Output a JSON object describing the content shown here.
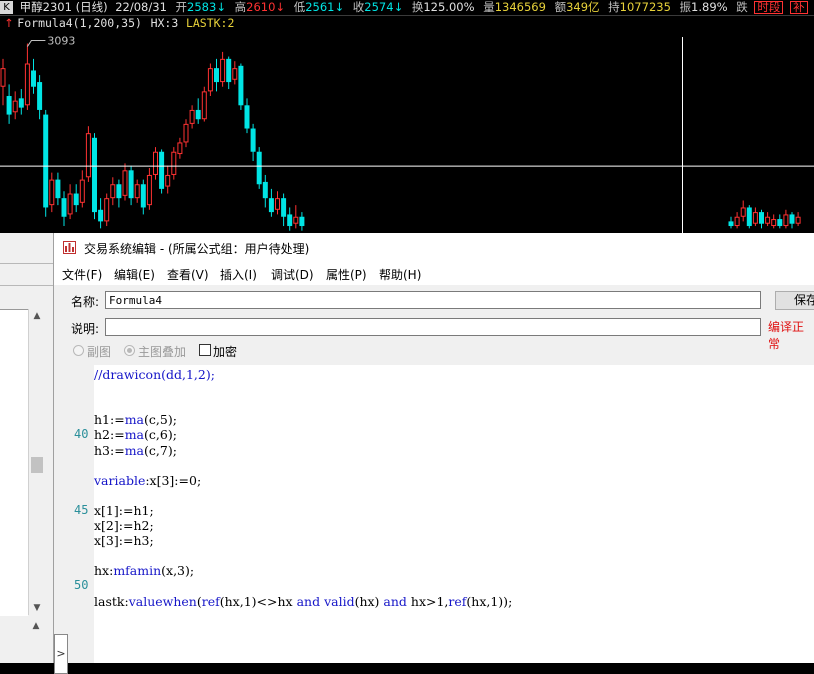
{
  "quote_bar": {
    "k_label": "K",
    "symbol": "甲醇2301",
    "period": "(日线)",
    "date": "22/08/31",
    "open_label": "开",
    "open_value": "2583",
    "open_arrow": "↓",
    "high_label": "高",
    "high_value": "2610",
    "high_arrow": "↓",
    "low_label": "低",
    "low_value": "2561",
    "low_arrow": "↓",
    "close_label": "收",
    "close_value": "2574",
    "close_arrow": "↓",
    "turnover_label": "换",
    "turnover_value": "125.00%",
    "volume_label": "量",
    "volume_value": "1346569",
    "amount_label": "额",
    "amount_value": "349亿",
    "oi_label": "持",
    "oi_value": "1077235",
    "change_label": "振",
    "change_value": "1.89%",
    "fall_label": "跌",
    "segment_button": "时段",
    "extra_button": "补"
  },
  "formula_bar": {
    "arrow": "↑",
    "formula": "Formula4(1,200,35)",
    "hx": "HX:3",
    "lastk": "LASTK:2"
  },
  "chart_data": {
    "type": "candlestick",
    "annotation": "3093",
    "colors": {
      "up": "#ff3232",
      "down": "#00e5e5",
      "crosshair": "#ffffff"
    },
    "crosshair": {
      "vertical_index": 52,
      "horizontal_price": 2830
    },
    "ylim": [
      2685,
      3120
    ],
    "candles": [
      {
        "o": 3000,
        "c": 3040,
        "h": 3060,
        "l": 2960
      },
      {
        "o": 2980,
        "c": 2940,
        "h": 3005,
        "l": 2920
      },
      {
        "o": 2945,
        "c": 2970,
        "h": 2990,
        "l": 2930
      },
      {
        "o": 2975,
        "c": 2955,
        "h": 2995,
        "l": 2940
      },
      {
        "o": 2960,
        "c": 3050,
        "h": 3093,
        "l": 2950
      },
      {
        "o": 3035,
        "c": 3000,
        "h": 3060,
        "l": 2985
      },
      {
        "o": 3010,
        "c": 2950,
        "h": 3025,
        "l": 2930
      },
      {
        "o": 2940,
        "c": 2740,
        "h": 2950,
        "l": 2720
      },
      {
        "o": 2745,
        "c": 2800,
        "h": 2815,
        "l": 2730
      },
      {
        "o": 2800,
        "c": 2760,
        "h": 2815,
        "l": 2745
      },
      {
        "o": 2760,
        "c": 2720,
        "h": 2775,
        "l": 2700
      },
      {
        "o": 2725,
        "c": 2770,
        "h": 2790,
        "l": 2715
      },
      {
        "o": 2770,
        "c": 2745,
        "h": 2790,
        "l": 2730
      },
      {
        "o": 2750,
        "c": 2800,
        "h": 2820,
        "l": 2740
      },
      {
        "o": 2805,
        "c": 2900,
        "h": 2915,
        "l": 2795
      },
      {
        "o": 2890,
        "c": 2730,
        "h": 2900,
        "l": 2715
      },
      {
        "o": 2735,
        "c": 2710,
        "h": 2760,
        "l": 2695
      },
      {
        "o": 2710,
        "c": 2760,
        "h": 2770,
        "l": 2700
      },
      {
        "o": 2760,
        "c": 2790,
        "h": 2805,
        "l": 2745
      },
      {
        "o": 2790,
        "c": 2760,
        "h": 2800,
        "l": 2740
      },
      {
        "o": 2765,
        "c": 2820,
        "h": 2835,
        "l": 2755
      },
      {
        "o": 2820,
        "c": 2760,
        "h": 2830,
        "l": 2745
      },
      {
        "o": 2760,
        "c": 2790,
        "h": 2800,
        "l": 2750
      },
      {
        "o": 2790,
        "c": 2740,
        "h": 2800,
        "l": 2725
      },
      {
        "o": 2745,
        "c": 2810,
        "h": 2825,
        "l": 2735
      },
      {
        "o": 2810,
        "c": 2860,
        "h": 2870,
        "l": 2800
      },
      {
        "o": 2860,
        "c": 2780,
        "h": 2865,
        "l": 2770
      },
      {
        "o": 2785,
        "c": 2810,
        "h": 2830,
        "l": 2770
      },
      {
        "o": 2810,
        "c": 2860,
        "h": 2870,
        "l": 2800
      },
      {
        "o": 2855,
        "c": 2880,
        "h": 2890,
        "l": 2845
      },
      {
        "o": 2880,
        "c": 2920,
        "h": 2930,
        "l": 2870
      },
      {
        "o": 2920,
        "c": 2950,
        "h": 2960,
        "l": 2910
      },
      {
        "o": 2950,
        "c": 2930,
        "h": 2975,
        "l": 2920
      },
      {
        "o": 2930,
        "c": 2990,
        "h": 3000,
        "l": 2925
      },
      {
        "o": 2990,
        "c": 3040,
        "h": 3050,
        "l": 2980
      },
      {
        "o": 3040,
        "c": 3010,
        "h": 3060,
        "l": 2990
      },
      {
        "o": 3010,
        "c": 3060,
        "h": 3075,
        "l": 3000
      },
      {
        "o": 3060,
        "c": 3010,
        "h": 3065,
        "l": 2995
      },
      {
        "o": 3015,
        "c": 3040,
        "h": 3055,
        "l": 3005
      },
      {
        "o": 3045,
        "c": 2960,
        "h": 3050,
        "l": 2950
      },
      {
        "o": 2960,
        "c": 2910,
        "h": 2975,
        "l": 2900
      },
      {
        "o": 2910,
        "c": 2860,
        "h": 2920,
        "l": 2840
      },
      {
        "o": 2860,
        "c": 2790,
        "h": 2870,
        "l": 2780
      },
      {
        "o": 2795,
        "c": 2760,
        "h": 2810,
        "l": 2740
      },
      {
        "o": 2760,
        "c": 2730,
        "h": 2780,
        "l": 2720
      },
      {
        "o": 2735,
        "c": 2760,
        "h": 2775,
        "l": 2725
      },
      {
        "o": 2760,
        "c": 2720,
        "h": 2770,
        "l": 2700
      },
      {
        "o": 2725,
        "c": 2700,
        "h": 2740,
        "l": 2690
      },
      {
        "o": 2705,
        "c": 2720,
        "h": 2745,
        "l": 2695
      },
      {
        "o": 2720,
        "c": 2700,
        "h": 2730,
        "l": 2690
      }
    ],
    "right_candles": [
      {
        "o": 2710,
        "c": 2700,
        "h": 2720,
        "l": 2695
      },
      {
        "o": 2700,
        "c": 2720,
        "h": 2730,
        "l": 2695
      },
      {
        "o": 2720,
        "c": 2740,
        "h": 2755,
        "l": 2710
      },
      {
        "o": 2740,
        "c": 2700,
        "h": 2745,
        "l": 2695
      },
      {
        "o": 2705,
        "c": 2730,
        "h": 2740,
        "l": 2700
      },
      {
        "o": 2730,
        "c": 2705,
        "h": 2735,
        "l": 2695
      },
      {
        "o": 2705,
        "c": 2720,
        "h": 2730,
        "l": 2700
      },
      {
        "o": 2700,
        "c": 2715,
        "h": 2725,
        "l": 2695
      },
      {
        "o": 2715,
        "c": 2700,
        "h": 2725,
        "l": 2695
      },
      {
        "o": 2700,
        "c": 2725,
        "h": 2735,
        "l": 2695
      },
      {
        "o": 2725,
        "c": 2705,
        "h": 2730,
        "l": 2695
      },
      {
        "o": 2705,
        "c": 2720,
        "h": 2730,
        "l": 2700
      }
    ]
  },
  "dialog": {
    "title": "交易系统编辑 - (所属公式组：用户待处理)",
    "menu": [
      "文件(F)",
      "编辑(E)",
      "查看(V)",
      "插入(I)",
      "调试(D)",
      "属性(P)",
      "帮助(H)"
    ],
    "name_label": "名称:",
    "name_value": "Formula4",
    "desc_label": "说明:",
    "desc_value": "",
    "save_button": "保存",
    "compile_status": "编译正常",
    "radio_sub": "副图",
    "radio_main": "主图叠加",
    "encrypt_label": "加密",
    "side_tab": ">",
    "line_numbers": [
      {
        "n": "40",
        "line": 4
      },
      {
        "n": "45",
        "line": 9
      },
      {
        "n": "50",
        "line": 14
      }
    ],
    "code_lines": [
      "//drawicon(dd,1,2);",
      "",
      "",
      "h1:=ma(c,5);",
      "h2:=ma(c,6);",
      "h3:=ma(c,7);",
      "",
      "variable:x[3]:=0;",
      "",
      "x[1]:=h1;",
      "x[2]:=h2;",
      "x[3]:=h3;",
      "",
      "hx:mfamin(x,3);",
      "",
      "lastk:valuewhen(ref(hx,1)<>hx and valid(hx) and hx>1,ref(hx,1));"
    ]
  }
}
